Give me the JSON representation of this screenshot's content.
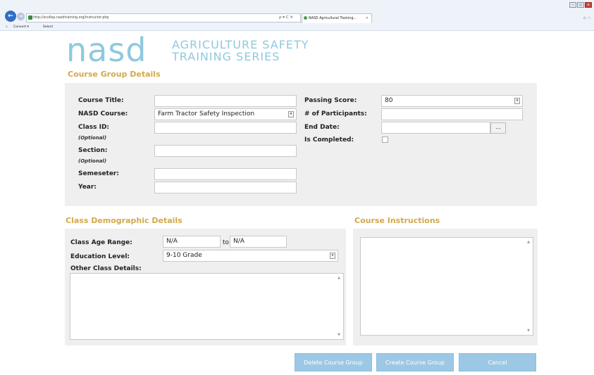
{
  "browser": {
    "url": "http://scollep.nasdtraining.org/instructor.php",
    "address_tools": "ρ ▾ C ✕",
    "tab_title": "NASD Agricultural Training...",
    "tab_close": "×",
    "favorites": {
      "close": "x",
      "convert": "Convert ▾",
      "select": "Select"
    },
    "window_controls": {
      "minimize": "–",
      "restore": "▫",
      "close": "x"
    },
    "corner_icons": "⌂ ☆"
  },
  "header": {
    "logo": "nasd",
    "tagline_line1": "AGRICULTURE SAFETY",
    "tagline_line2": "TRAINING SERIES"
  },
  "course_group": {
    "title": "Course Group Details",
    "course_title_label": "Course Title:",
    "course_title_value": "",
    "nasd_course_label": "NASD Course:",
    "nasd_course_value": "Farm Tractor Safety Inspection",
    "class_id_label": "Class ID:",
    "class_id_optional": "(Optional)",
    "class_id_value": "",
    "section_label": "Section:",
    "section_optional": "(Optional)",
    "section_value": "",
    "semester_label": "Semeseter:",
    "semester_value": "",
    "year_label": "Year:",
    "year_value": "",
    "passing_score_label": "Passing Score:",
    "passing_score_value": "80",
    "participants_label": "# of Participants:",
    "participants_value": "",
    "end_date_label": "End Date:",
    "end_date_value": "",
    "end_date_button": "...",
    "is_completed_label": "Is Completed:",
    "is_completed_checked": false
  },
  "demographics": {
    "title": "Class Demographic Details",
    "age_range_label": "Class Age Range:",
    "age_from": "N/A",
    "age_to_label": "to",
    "age_to": "N/A",
    "education_label": "Education Level:",
    "education_value": "9-10 Grade",
    "other_details_label": "Other Class Details:"
  },
  "instructions": {
    "title": "Course Instructions"
  },
  "actions": {
    "delete": "Delete Course Group",
    "create": "Create Course Group",
    "cancel": "Cancel"
  },
  "colors": {
    "accent_gold": "#d4a84a",
    "logo_blue": "#8ec9df",
    "button_blue": "#9cc8e6",
    "panel_gray": "#efefef"
  }
}
